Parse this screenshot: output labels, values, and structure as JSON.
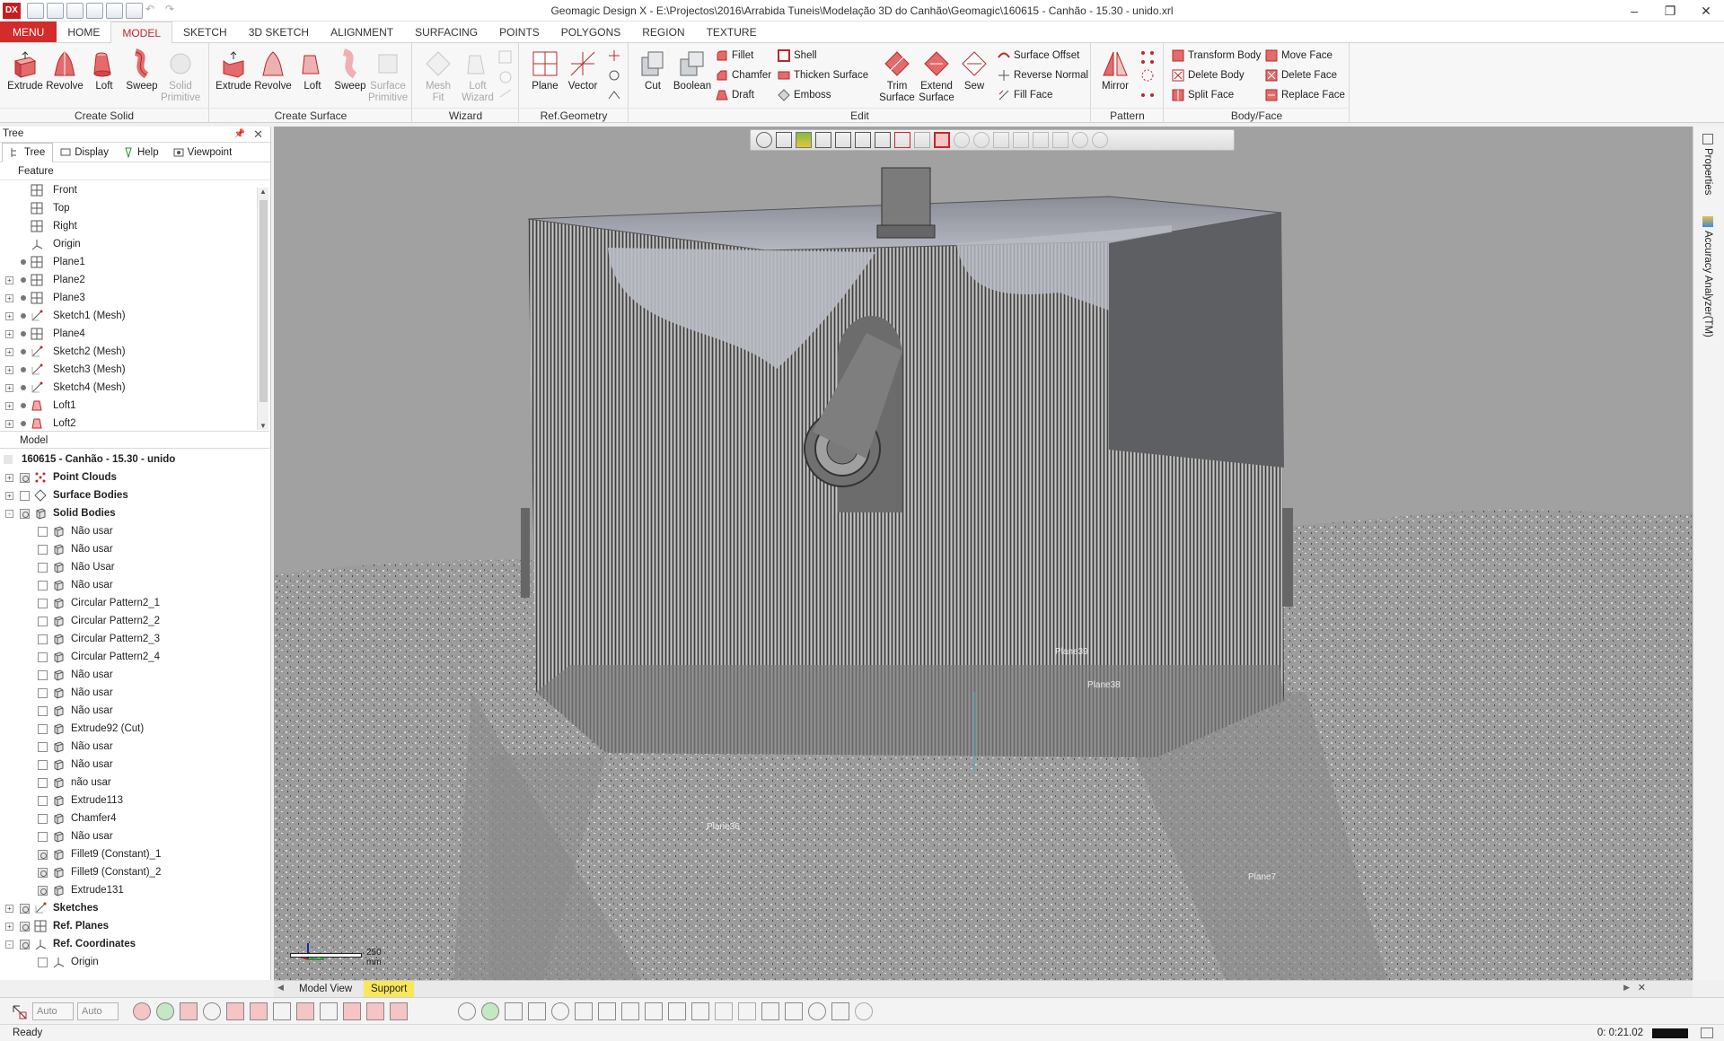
{
  "window": {
    "title": "Geomagic Design X - E:\\Projectos\\2016\\Arrabida Tuneis\\Modelação 3D do Canhão\\Geomagic\\160615 - Canhão - 15.30 - unido.xrl",
    "logo": "DX"
  },
  "tabs": [
    "MENU",
    "HOME",
    "MODEL",
    "SKETCH",
    "3D SKETCH",
    "ALIGNMENT",
    "SURFACING",
    "POINTS",
    "POLYGONS",
    "REGION",
    "TEXTURE"
  ],
  "ribbon": {
    "create_solid": {
      "label": "Create Solid",
      "buttons": [
        "Extrude",
        "Revolve",
        "Loft",
        "Sweep",
        "Solid Primitive"
      ]
    },
    "create_surface": {
      "label": "Create Surface",
      "buttons": [
        "Extrude",
        "Revolve",
        "Loft",
        "Sweep",
        "Surface Primitive"
      ]
    },
    "wizard": {
      "label": "Wizard",
      "buttons": [
        "Mesh Fit",
        "Loft Wizard"
      ]
    },
    "ref_geometry": {
      "label": "Ref.Geometry",
      "buttons": [
        "Plane",
        "Vector"
      ]
    },
    "edit": {
      "label": "Edit",
      "buttons": [
        "Cut",
        "Boolean"
      ],
      "col1": [
        "Fillet",
        "Chamfer",
        "Draft"
      ],
      "col2": [
        "Shell",
        "Thicken Surface",
        "Emboss"
      ],
      "buttons2": [
        "Trim Surface",
        "Extend Surface",
        "Sew"
      ],
      "col3": [
        "Surface Offset",
        "Reverse Normal",
        "Fill Face"
      ]
    },
    "pattern": {
      "label": "Pattern",
      "buttons": [
        "Mirror"
      ]
    },
    "body_face": {
      "label": "Body/Face",
      "col1": [
        "Transform Body",
        "Delete Body",
        "Split Face"
      ],
      "col2": [
        "Move Face",
        "Delete Face",
        "Replace Face"
      ]
    }
  },
  "panel": {
    "title": "Tree",
    "tabs": [
      "Tree",
      "Display",
      "Help",
      "Viewpoint"
    ],
    "feature_header": "Feature",
    "features": [
      {
        "label": "Front",
        "kind": "plane",
        "dot": false,
        "exp": false
      },
      {
        "label": "Top",
        "kind": "plane",
        "dot": false,
        "exp": false
      },
      {
        "label": "Right",
        "kind": "plane",
        "dot": false,
        "exp": false
      },
      {
        "label": "Origin",
        "kind": "axis",
        "dot": false,
        "exp": false
      },
      {
        "label": "Plane1",
        "kind": "plane",
        "dot": true,
        "exp": false
      },
      {
        "label": "Plane2",
        "kind": "plane",
        "dot": true,
        "exp": true
      },
      {
        "label": "Plane3",
        "kind": "plane",
        "dot": true,
        "exp": true
      },
      {
        "label": "Sketch1 (Mesh)",
        "kind": "sketch",
        "dot": true,
        "exp": true
      },
      {
        "label": "Plane4",
        "kind": "plane",
        "dot": true,
        "exp": true
      },
      {
        "label": "Sketch2 (Mesh)",
        "kind": "sketch",
        "dot": true,
        "exp": true
      },
      {
        "label": "Sketch3 (Mesh)",
        "kind": "sketch",
        "dot": true,
        "exp": true
      },
      {
        "label": "Sketch4 (Mesh)",
        "kind": "sketch",
        "dot": true,
        "exp": true
      },
      {
        "label": "Loft1",
        "kind": "loft",
        "dot": true,
        "exp": true
      },
      {
        "label": "Loft2",
        "kind": "loft",
        "dot": true,
        "exp": true
      }
    ],
    "model_header": "Model",
    "model_root": "160615 - Canhão - 15.30 - unido",
    "model": [
      {
        "label": "Point Clouds",
        "lvl": 0,
        "exp": "+",
        "chk": "on",
        "kind": "points",
        "bold": true
      },
      {
        "label": "Surface Bodies",
        "lvl": 0,
        "exp": "+",
        "chk": "off",
        "kind": "surface",
        "bold": true
      },
      {
        "label": "Solid Bodies",
        "lvl": 0,
        "exp": "-",
        "chk": "on",
        "kind": "solid",
        "bold": true
      },
      {
        "label": "Não usar",
        "lvl": 1,
        "chk": "off",
        "kind": "solid"
      },
      {
        "label": "Não usar",
        "lvl": 1,
        "chk": "off",
        "kind": "solid"
      },
      {
        "label": "Não Usar",
        "lvl": 1,
        "chk": "off",
        "kind": "solid"
      },
      {
        "label": "Não usar",
        "lvl": 1,
        "chk": "off",
        "kind": "solid"
      },
      {
        "label": "Circular Pattern2_1",
        "lvl": 1,
        "chk": "off",
        "kind": "solid"
      },
      {
        "label": "Circular Pattern2_2",
        "lvl": 1,
        "chk": "off",
        "kind": "solid"
      },
      {
        "label": "Circular Pattern2_3",
        "lvl": 1,
        "chk": "off",
        "kind": "solid"
      },
      {
        "label": "Circular Pattern2_4",
        "lvl": 1,
        "chk": "off",
        "kind": "solid"
      },
      {
        "label": "Não usar",
        "lvl": 1,
        "chk": "off",
        "kind": "solid"
      },
      {
        "label": "Não usar",
        "lvl": 1,
        "chk": "off",
        "kind": "solid"
      },
      {
        "label": "Não usar",
        "lvl": 1,
        "chk": "off",
        "kind": "solid"
      },
      {
        "label": "Extrude92 (Cut)",
        "lvl": 1,
        "chk": "off",
        "kind": "solid"
      },
      {
        "label": "Não usar",
        "lvl": 1,
        "chk": "off",
        "kind": "solid"
      },
      {
        "label": "Não usar",
        "lvl": 1,
        "chk": "off",
        "kind": "solid"
      },
      {
        "label": "não usar",
        "lvl": 1,
        "chk": "off",
        "kind": "solid"
      },
      {
        "label": "Extrude113",
        "lvl": 1,
        "chk": "off",
        "kind": "solid"
      },
      {
        "label": "Chamfer4",
        "lvl": 1,
        "chk": "off",
        "kind": "solid"
      },
      {
        "label": "Não usar",
        "lvl": 1,
        "chk": "off",
        "kind": "solid"
      },
      {
        "label": "Fillet9 (Constant)_1",
        "lvl": 1,
        "chk": "on",
        "kind": "solid"
      },
      {
        "label": "Fillet9 (Constant)_2",
        "lvl": 1,
        "chk": "on",
        "kind": "solid"
      },
      {
        "label": "Extrude131",
        "lvl": 1,
        "chk": "on",
        "kind": "solid"
      },
      {
        "label": "Sketches",
        "lvl": 0,
        "exp": "+",
        "chk": "on",
        "kind": "sketch",
        "bold": true
      },
      {
        "label": "Ref. Planes",
        "lvl": 0,
        "exp": "+",
        "chk": "on",
        "kind": "plane",
        "bold": true
      },
      {
        "label": "Ref. Coordinates",
        "lvl": 0,
        "exp": "-",
        "chk": "on",
        "kind": "axis",
        "bold": true
      },
      {
        "label": "Origin",
        "lvl": 1,
        "chk": "off",
        "kind": "axis"
      }
    ]
  },
  "viewport": {
    "plane_labels": [
      "Plane39",
      "Plane38",
      "Plane36",
      "Plane7"
    ],
    "scale_label": "250 mm"
  },
  "right_tabs": [
    "Properties",
    "Accuracy Analyzer(TM)"
  ],
  "view_tabs": [
    "Model View",
    "Support"
  ],
  "bottom": {
    "sel1": "Auto",
    "sel2": "Auto"
  },
  "status": {
    "text": "Ready",
    "time": "0: 0:21.02"
  },
  "colors": {
    "accent": "#c0272d",
    "menu_red": "#d42b2b",
    "support_tab": "#f9e65a",
    "viewport_bg": "#a1a1a1"
  }
}
